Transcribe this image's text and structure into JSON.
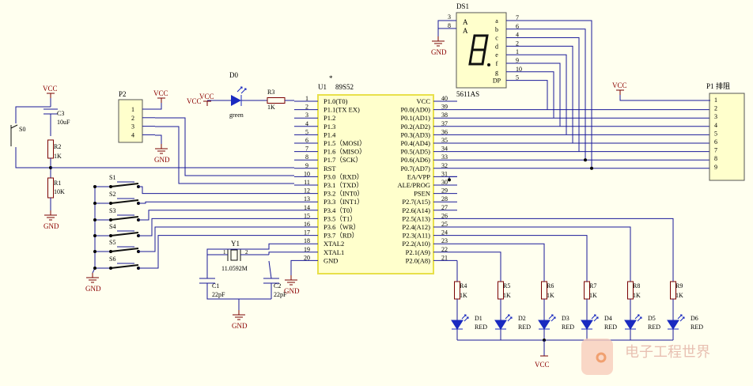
{
  "colors": {
    "background": "#ffffef",
    "wire": "#1a1a9a",
    "part": "#9a1a1a",
    "ic_fill": "#ffffcc",
    "ic_border": "#e8e04a",
    "led": "#1a2ac0"
  },
  "mcu": {
    "designator": "U1",
    "part": "89S52",
    "star": "*",
    "left_pins": [
      {
        "num": "1",
        "name": "P1.0(T0)"
      },
      {
        "num": "2",
        "name": "P1.1(TX EX)"
      },
      {
        "num": "3",
        "name": "P1.2"
      },
      {
        "num": "4",
        "name": "P1.3"
      },
      {
        "num": "5",
        "name": "P1.4"
      },
      {
        "num": "6",
        "name": "P1.5（MOSI）"
      },
      {
        "num": "7",
        "name": "P1.6（MISO）"
      },
      {
        "num": "8",
        "name": "P1.7（SCK）"
      },
      {
        "num": "9",
        "name": "RST"
      },
      {
        "num": "10",
        "name": "P3.0（RXD）"
      },
      {
        "num": "11",
        "name": "P3.1（TXD）"
      },
      {
        "num": "12",
        "name": "P3.2（INT0）"
      },
      {
        "num": "13",
        "name": "P3.3（INT1）"
      },
      {
        "num": "14",
        "name": "P3.4（T0）"
      },
      {
        "num": "15",
        "name": "P3.5（T1）"
      },
      {
        "num": "16",
        "name": "P3.6（WR）"
      },
      {
        "num": "17",
        "name": "P3.7（RD）"
      },
      {
        "num": "18",
        "name": "XTAL2"
      },
      {
        "num": "19",
        "name": "XTAL1"
      },
      {
        "num": "20",
        "name": "GND"
      }
    ],
    "right_pins": [
      {
        "num": "40",
        "name": "VCC"
      },
      {
        "num": "39",
        "name": "P0.0(AD0)"
      },
      {
        "num": "38",
        "name": "P0.1(AD1)"
      },
      {
        "num": "37",
        "name": "P0.2(AD2)"
      },
      {
        "num": "36",
        "name": "P0.3(AD3)"
      },
      {
        "num": "35",
        "name": "P0.4(AD4)"
      },
      {
        "num": "34",
        "name": "P0.5(AD5)"
      },
      {
        "num": "33",
        "name": "P0.6(AD6)"
      },
      {
        "num": "32",
        "name": "P0.7(AD7)"
      },
      {
        "num": "31",
        "name": "EA/VPP"
      },
      {
        "num": "30",
        "name": "ALE/PROG"
      },
      {
        "num": "29",
        "name": "PSEN"
      },
      {
        "num": "28",
        "name": "P2.7(A15)"
      },
      {
        "num": "27",
        "name": "P2.6(A14)"
      },
      {
        "num": "26",
        "name": "P2.5(A13)"
      },
      {
        "num": "25",
        "name": "P2.4(A12)"
      },
      {
        "num": "24",
        "name": "P2.3(A11)"
      },
      {
        "num": "23",
        "name": "P2.2(A10)"
      },
      {
        "num": "22",
        "name": "P2.1(A9)"
      },
      {
        "num": "21",
        "name": "P2.0(A8)"
      }
    ]
  },
  "display": {
    "designator": "DS1",
    "part": "5611AS",
    "anode_label": "A",
    "common_pins": [
      "3",
      "8"
    ],
    "segments": [
      {
        "letter": "a",
        "pin": "7"
      },
      {
        "letter": "b",
        "pin": "6"
      },
      {
        "letter": "c",
        "pin": "4"
      },
      {
        "letter": "d",
        "pin": "2"
      },
      {
        "letter": "e",
        "pin": "1"
      },
      {
        "letter": "f",
        "pin": "9"
      },
      {
        "letter": "g",
        "pin": "10"
      },
      {
        "letter": "DP",
        "pin": "5"
      }
    ]
  },
  "resnet": {
    "designator": "P1",
    "name": "排阻",
    "pins": [
      "1",
      "2",
      "3",
      "4",
      "5",
      "6",
      "7",
      "8",
      "9"
    ]
  },
  "header": {
    "designator": "P2",
    "pins": [
      "1",
      "2",
      "3",
      "4"
    ]
  },
  "reset": {
    "switch": "S0",
    "cap": "C3",
    "cap_value": "10uF",
    "r2": "R2",
    "r2_value": "1K",
    "r1": "R1",
    "r1_value": "10K"
  },
  "status_led": {
    "designator": "D0",
    "color": "green",
    "resistor": "R3",
    "resistor_value": "1K"
  },
  "switches": [
    "S1",
    "S2",
    "S3",
    "S4",
    "S5",
    "S6"
  ],
  "crystal": {
    "designator": "Y1",
    "value": "11.0592M",
    "pin1": "1",
    "pin2": "2"
  },
  "caps": [
    {
      "designator": "C1",
      "value": "22pF"
    },
    {
      "designator": "C2",
      "value": "22pF"
    }
  ],
  "leds": [
    {
      "led": "D1",
      "res": "R4",
      "res_value": "1K",
      "color": "RED"
    },
    {
      "led": "D2",
      "res": "R5",
      "res_value": "1K",
      "color": "RED"
    },
    {
      "led": "D3",
      "res": "R6",
      "res_value": "1K",
      "color": "RED"
    },
    {
      "led": "D4",
      "res": "R7",
      "res_value": "1K",
      "color": "RED"
    },
    {
      "led": "D5",
      "res": "R8",
      "res_value": "1K",
      "color": "RED"
    },
    {
      "led": "D6",
      "res": "R9",
      "res_value": "1K",
      "color": "RED"
    }
  ],
  "power": {
    "vcc": "VCC",
    "gnd": "GND"
  },
  "watermark": {
    "text": "电子工程世界"
  }
}
